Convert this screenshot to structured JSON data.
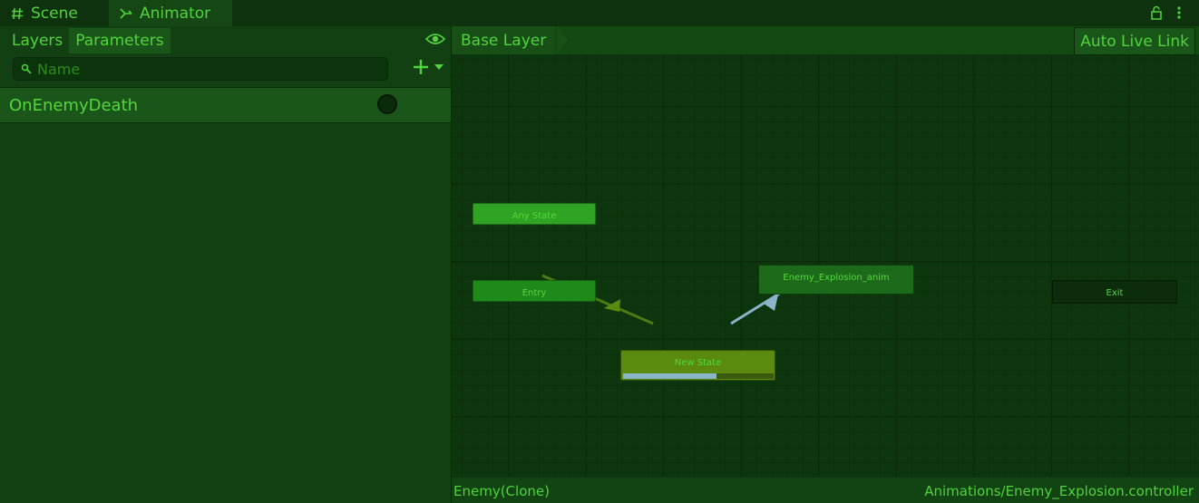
{
  "tabs": {
    "scene": {
      "label": "Scene",
      "icon": "hash-icon"
    },
    "animator": {
      "label": "Animator",
      "icon": "animator-icon"
    }
  },
  "window_icons": [
    "lock-icon",
    "more-icon"
  ],
  "left_panel": {
    "tabs": [
      {
        "label": "Layers"
      },
      {
        "label": "Parameters",
        "active": true
      }
    ],
    "search": {
      "placeholder": "Name",
      "value": ""
    },
    "parameters": [
      {
        "name": "OnEnemyDeath",
        "type": "trigger"
      }
    ]
  },
  "graph": {
    "breadcrumb": "Base Layer",
    "auto_live_link": "Auto Live Link",
    "nodes": {
      "any_state": "Any State",
      "entry": "Entry",
      "explosion": "Enemy_Explosion_anim",
      "exit": "Exit",
      "new_state": "New State"
    },
    "new_state_progress": 0.62
  },
  "status": {
    "left": "Enemy(Clone)",
    "right": "Animations/Enemy_Explosion.controller"
  },
  "colors": {
    "accent": "#52d33c",
    "bg": "#0f3a0f",
    "default_state": "#5a8a10",
    "transition_active": "#8ab4c8",
    "transition_entry": "#4e7a14"
  }
}
